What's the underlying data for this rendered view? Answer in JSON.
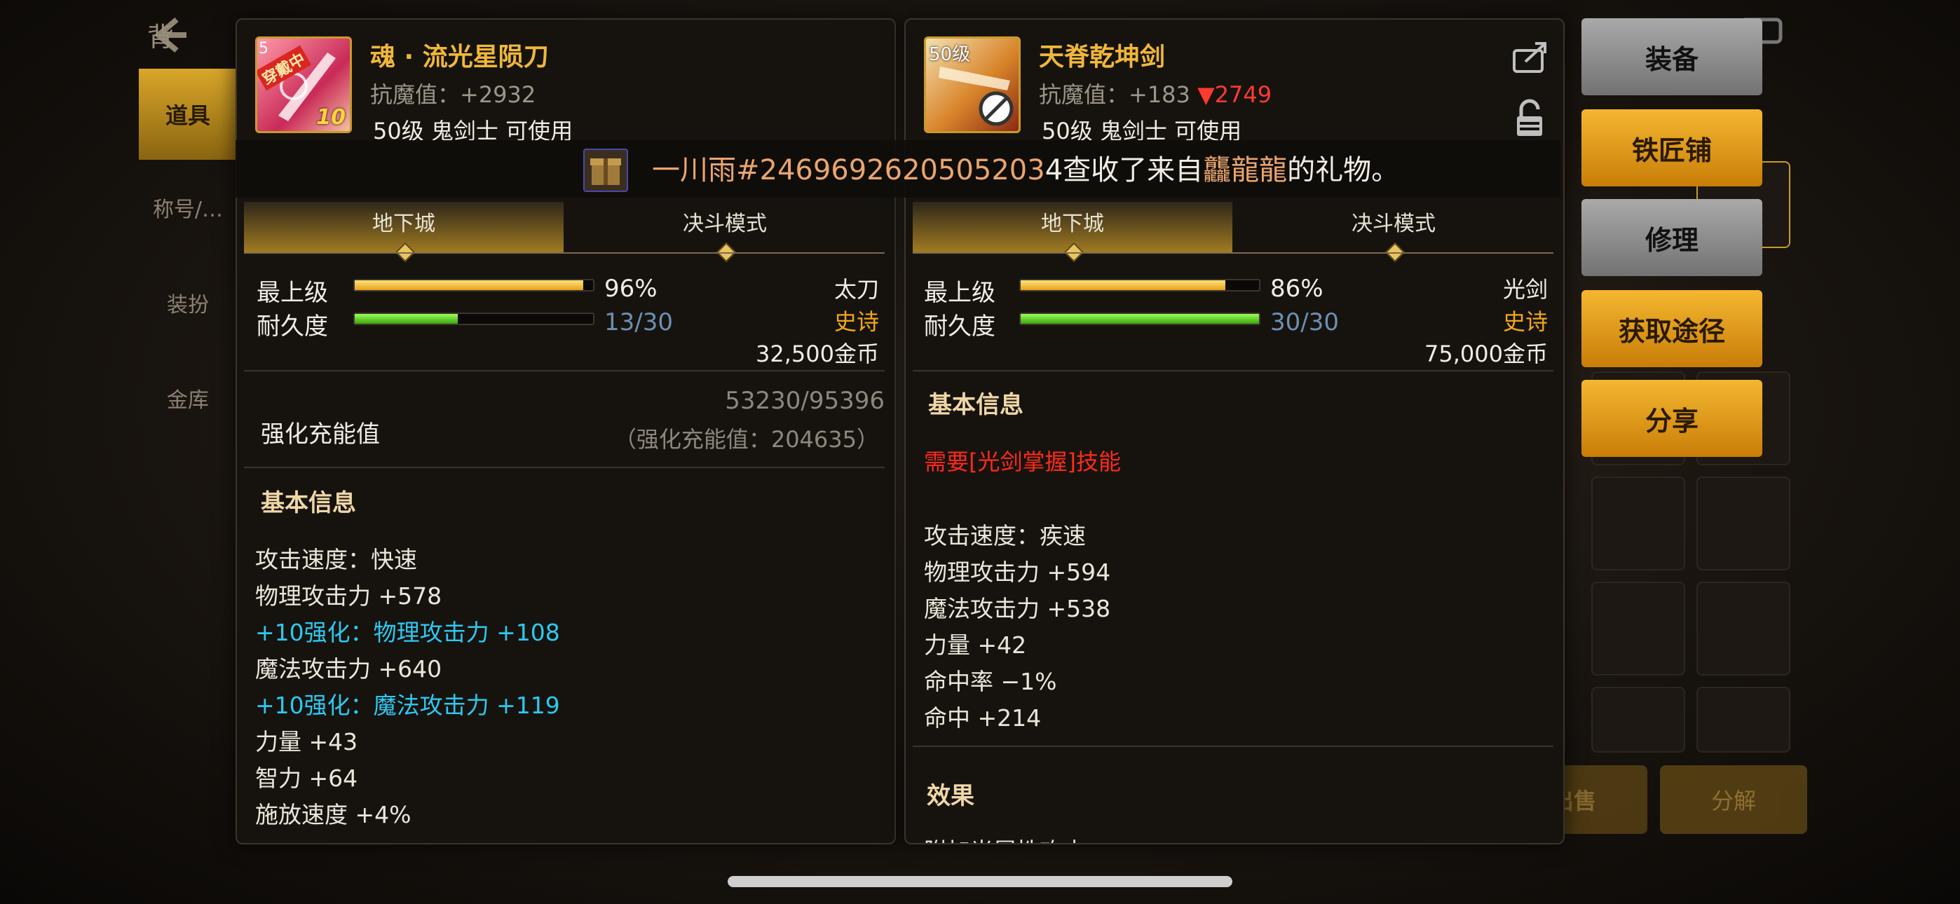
{
  "background": {
    "title": "背",
    "nav_active": "道具",
    "nav_items": [
      "称号/…",
      "装扮",
      "金库"
    ],
    "sell_label": "出售",
    "decompose_label": "分解"
  },
  "banner": {
    "player": "一川雨#2469692620505203",
    "suffix": "4查收了来自",
    "sender": "龘龍龍",
    "end": "的礼物。"
  },
  "left_item": {
    "equipped_badge": "穿戴中",
    "level_corner": "5",
    "enhance_level": "10",
    "name": "魂 · 流光星陨刀",
    "anti_demon": "抗魔值：+2932",
    "requirement": "50级 鬼剑士 可使用",
    "tabs": [
      "地下城",
      "决斗模式"
    ],
    "grade_label": "最上级",
    "grade_pct": "96%",
    "grade_value": 0.96,
    "durability_label": "耐久度",
    "durability": "13/30",
    "durability_value": 0.433,
    "type": "太刀",
    "rarity": "史诗",
    "price": "32,500金币",
    "charge_label": "强化充能值",
    "charge_progress": "53230/95396",
    "charge_total": "（强化充能值：204635）",
    "section_basic": "基本信息",
    "stats": [
      {
        "text": "攻击速度：快速",
        "style": "normal"
      },
      {
        "text": "物理攻击力 +578",
        "style": "normal"
      },
      {
        "text": "+10强化：物理攻击力 +108",
        "style": "blue"
      },
      {
        "text": "魔法攻击力 +640",
        "style": "normal"
      },
      {
        "text": "+10强化：魔法攻击力 +119",
        "style": "blue"
      },
      {
        "text": "力量 +43",
        "style": "normal"
      },
      {
        "text": "智力 +64",
        "style": "normal"
      },
      {
        "text": "施放速度 +4%",
        "style": "normal"
      }
    ]
  },
  "right_item": {
    "level_badge": "50级",
    "name": "天脊乾坤剑",
    "anti_demon": "抗魔值：+183",
    "anti_diff": "▼2749",
    "requirement": "50级 鬼剑士 可使用",
    "tabs": [
      "地下城",
      "决斗模式"
    ],
    "grade_label": "最上级",
    "grade_pct": "86%",
    "grade_value": 0.86,
    "durability_label": "耐久度",
    "durability": "30/30",
    "durability_value": 1.0,
    "type": "光剑",
    "rarity": "史诗",
    "price": "75,000金币",
    "section_basic": "基本信息",
    "skill_req": "需要[光剑掌握]技能",
    "stats": [
      "攻击速度：疾速",
      "物理攻击力 +594",
      "魔法攻击力 +538",
      "力量 +42",
      "命中率 −1%",
      "命中 +214"
    ],
    "section_effect": "效果",
    "effect_cut": "附加光属性攻击"
  },
  "actions": [
    "装备",
    "铁匠铺",
    "修理",
    "获取途径",
    "分享"
  ],
  "colors": {
    "gold_accent": "#f0b73a",
    "enhance_blue": "#2ec8f0",
    "warn_red": "#ff2a1a",
    "rarity_orange": "#f2a71c"
  }
}
